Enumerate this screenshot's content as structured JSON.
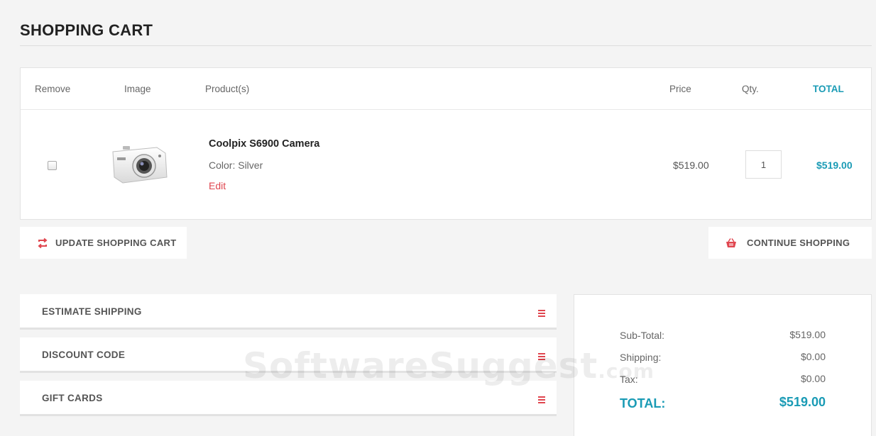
{
  "page": {
    "title": "SHOPPING CART"
  },
  "cart": {
    "columns": {
      "remove": "Remove",
      "image": "Image",
      "product": "Product(s)",
      "price": "Price",
      "qty": "Qty.",
      "total": "TOTAL"
    },
    "items": [
      {
        "name": "Coolpix S6900 Camera",
        "color": "Color: Silver",
        "edit_label": "Edit",
        "price": "$519.00",
        "qty": "1",
        "total": "$519.00",
        "checked": false,
        "image_icon": "camera-image"
      }
    ]
  },
  "actions": {
    "update": "UPDATE SHOPPING CART",
    "continue": "CONTINUE SHOPPING"
  },
  "panels": [
    {
      "label": "ESTIMATE SHIPPING"
    },
    {
      "label": "DISCOUNT CODE"
    },
    {
      "label": "GIFT CARDS"
    }
  ],
  "summary": {
    "subtotal_label": "Sub-Total:",
    "subtotal_value": "$519.00",
    "shipping_label": "Shipping:",
    "shipping_value": "$0.00",
    "tax_label": "Tax:",
    "tax_value": "$0.00",
    "total_label": "TOTAL:",
    "total_value": "$519.00"
  },
  "watermark": {
    "text": "SoftwareSuggest",
    "suffix": ".com"
  },
  "colors": {
    "accent": "#1a9bb5",
    "danger": "#e0464f",
    "background": "#f4f4f4"
  }
}
